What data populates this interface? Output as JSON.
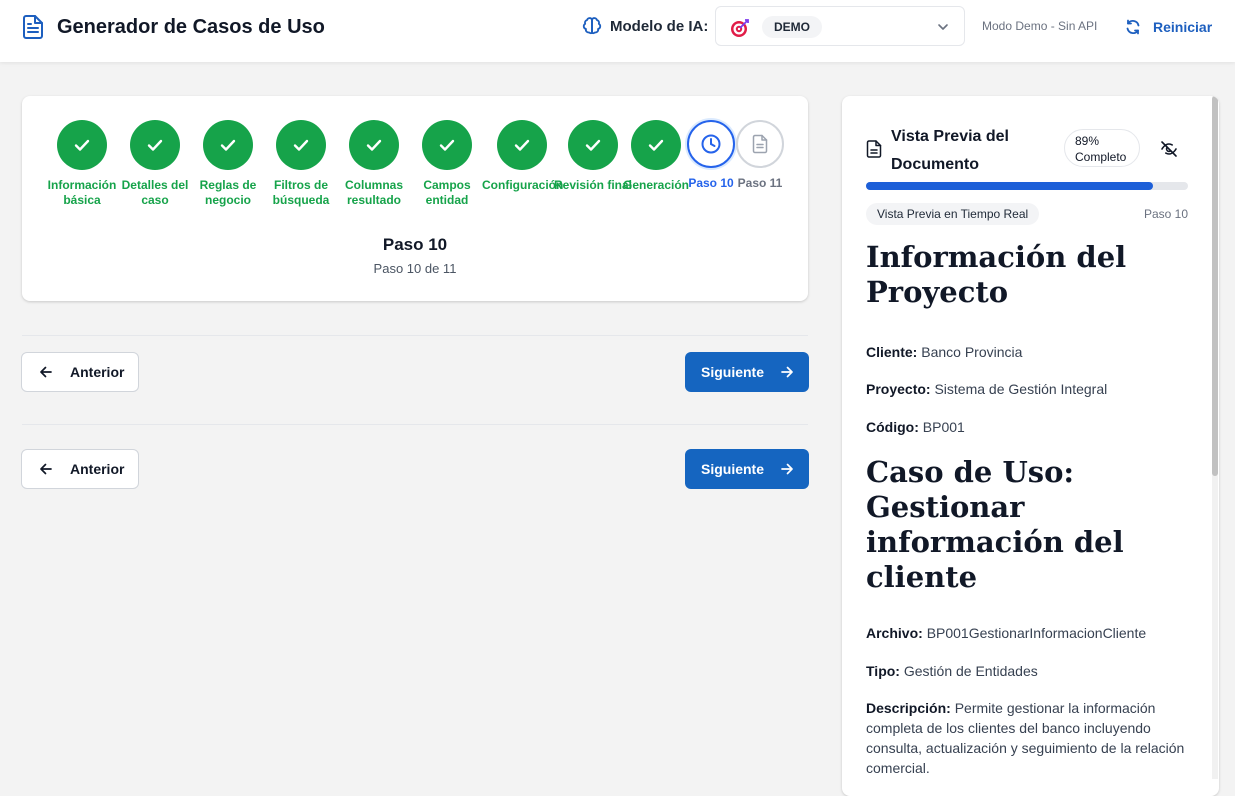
{
  "header": {
    "title": "Generador de Casos de Uso",
    "model_label": "Modelo de IA:",
    "model_selected": "DEMO",
    "mode_text": "Modo Demo - Sin API",
    "restart_label": "Reiniciar"
  },
  "colors": {
    "primary": "#1565c0",
    "success": "#16a34a",
    "current": "#2563eb"
  },
  "stepper": {
    "steps": [
      {
        "label": "Información básica",
        "status": "done"
      },
      {
        "label": "Detalles del caso",
        "status": "done"
      },
      {
        "label": "Reglas de negocio",
        "status": "done"
      },
      {
        "label": "Filtros de búsqueda",
        "status": "done"
      },
      {
        "label": "Columnas resultado",
        "status": "done"
      },
      {
        "label": "Campos entidad",
        "status": "done"
      },
      {
        "label": "Configuración",
        "status": "done"
      },
      {
        "label": "Revisión final",
        "status": "done"
      },
      {
        "label": "Generación",
        "status": "done"
      },
      {
        "label": "Paso 10",
        "status": "current"
      },
      {
        "label": "Paso 11",
        "status": "pending"
      }
    ],
    "current_title": "Paso 10",
    "current_subtitle": "Paso 10 de 11"
  },
  "nav": {
    "prev_label": "Anterior",
    "next_label": "Siguiente"
  },
  "preview": {
    "title": "Vista Previa del Documento",
    "progress_percent": 89,
    "progress_badge": "89% Completo",
    "realtime_badge": "Vista Previa en Tiempo Real",
    "step_label": "Paso 10",
    "doc": {
      "h1_project": "Información del Proyecto",
      "client_label": "Cliente:",
      "client_value": "Banco Provincia",
      "project_label": "Proyecto:",
      "project_value": "Sistema de Gestión Integral",
      "code_label": "Código:",
      "code_value": "BP001",
      "h1_case": "Caso de Uso: Gestionar información del cliente",
      "file_label": "Archivo:",
      "file_value": "BP001GestionarInformacionCliente",
      "type_label": "Tipo:",
      "type_value": "Gestión de Entidades",
      "desc_label": "Descripción:",
      "desc_value": "Permite gestionar la información completa de los clientes del banco incluyendo consulta, actualización y seguimiento de la relación comercial."
    }
  }
}
